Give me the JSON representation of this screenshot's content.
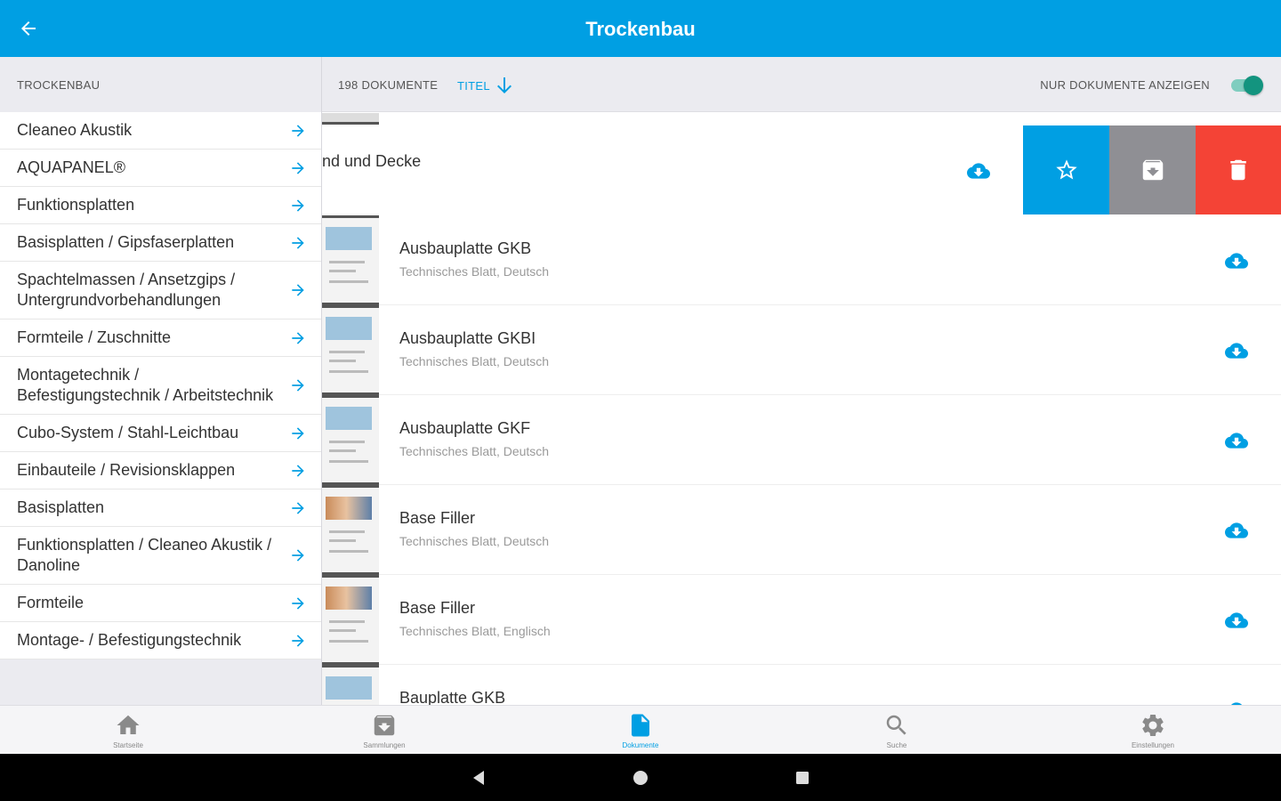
{
  "appbar": {
    "title": "Trockenbau",
    "back_icon": "arrow-left-icon",
    "color": "#009fe3"
  },
  "sidebar": {
    "header": "TROCKENBAU",
    "items": [
      {
        "label": "Cleaneo Akustik"
      },
      {
        "label": "AQUAPANEL®"
      },
      {
        "label": "Funktionsplatten"
      },
      {
        "label": "Basisplatten / Gipsfaserplatten"
      },
      {
        "label": "Spachtelmassen / Ansetzgips / Untergrundvorbehandlungen"
      },
      {
        "label": "Formteile / Zuschnitte"
      },
      {
        "label": "Montagetechnik / Befestigungstechnik / Arbeitstechnik"
      },
      {
        "label": "Cubo-System / Stahl-Leichtbau"
      },
      {
        "label": "Einbauteile / Revisionsklappen"
      },
      {
        "label": "Basisplatten"
      },
      {
        "label": "Funktionsplatten / Cleaneo Akustik / Danoline"
      },
      {
        "label": "Formteile"
      },
      {
        "label": "Montage- / Befestigungstechnik"
      }
    ]
  },
  "toolbar": {
    "count": "198 DOKUMENTE",
    "sort_label": "TITEL",
    "sort_icon": "arrow-down-icon",
    "toggle_label": "NUR DOKUMENTE ANZEIGEN",
    "toggle_on": true
  },
  "documents": {
    "swiped_title": "nd und Decke",
    "actions": {
      "favorite_icon": "star-outline-icon",
      "collection_icon": "archive-icon",
      "delete_icon": "trash-icon"
    },
    "items": [
      {
        "title": "Ausbauplatte GKB",
        "subtitle": "Technisches Blatt, Deutsch"
      },
      {
        "title": "Ausbauplatte GKBI",
        "subtitle": "Technisches Blatt, Deutsch"
      },
      {
        "title": "Ausbauplatte GKF",
        "subtitle": "Technisches Blatt, Deutsch"
      },
      {
        "title": "Base Filler",
        "subtitle": "Technisches Blatt, Deutsch"
      },
      {
        "title": "Base Filler",
        "subtitle": "Technisches Blatt, Englisch"
      },
      {
        "title": "Bauplatte GKB",
        "subtitle": ""
      }
    ]
  },
  "bottom_nav": {
    "tabs": [
      {
        "label": "Startseite",
        "icon": "home-icon"
      },
      {
        "label": "Sammlungen",
        "icon": "archive-icon"
      },
      {
        "label": "Dokumente",
        "icon": "document-icon",
        "active": true
      },
      {
        "label": "Suche",
        "icon": "search-icon"
      },
      {
        "label": "Einstellungen",
        "icon": "gear-icon"
      }
    ]
  },
  "system_nav": {
    "back_icon": "triangle-back-icon",
    "home_icon": "circle-home-icon",
    "recents_icon": "square-recents-icon"
  },
  "colors": {
    "primary": "#009fe3",
    "delete": "#f44336",
    "collection": "#8f8f94",
    "toggle": "#13947f"
  }
}
